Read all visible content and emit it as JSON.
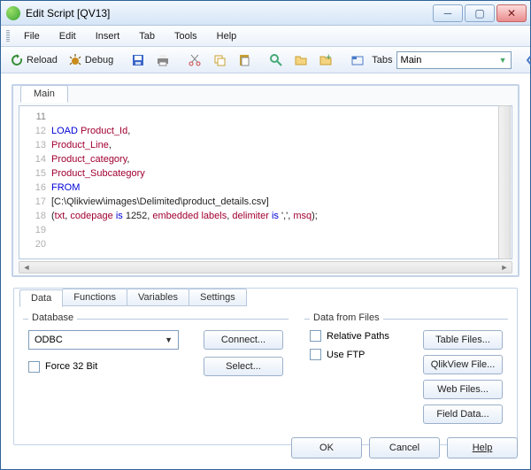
{
  "window": {
    "title": "Edit Script [QV13]"
  },
  "menu": {
    "file": "File",
    "edit": "Edit",
    "insert": "Insert",
    "tab": "Tab",
    "tools": "Tools",
    "help": "Help"
  },
  "toolbar": {
    "reload": "Reload",
    "debug": "Debug",
    "tabs_label": "Tabs",
    "tabs_value": "Main"
  },
  "editor": {
    "tab": "Main",
    "lines": [
      {
        "n": 11,
        "frag": []
      },
      {
        "n": 12,
        "frag": [
          [
            "kw",
            "LOAD"
          ],
          [
            "plain",
            " "
          ],
          [
            "id",
            "Product_Id"
          ],
          [
            "plain",
            ","
          ]
        ]
      },
      {
        "n": 13,
        "frag": [
          [
            "plain",
            "     "
          ],
          [
            "id",
            "Product_Line"
          ],
          [
            "plain",
            ","
          ]
        ]
      },
      {
        "n": 14,
        "frag": [
          [
            "plain",
            "     "
          ],
          [
            "id",
            "Product_category"
          ],
          [
            "plain",
            ","
          ]
        ]
      },
      {
        "n": 15,
        "frag": [
          [
            "plain",
            "     "
          ],
          [
            "id",
            "Product_Subcategory"
          ]
        ]
      },
      {
        "n": 16,
        "frag": [
          [
            "kw",
            "FROM"
          ]
        ]
      },
      {
        "n": 17,
        "frag": [
          [
            "plain",
            "[C:\\Qlikview\\images\\Delimited\\product_details.csv]"
          ]
        ]
      },
      {
        "n": 18,
        "frag": [
          [
            "plain",
            "("
          ],
          [
            "id",
            "txt"
          ],
          [
            "plain",
            ", "
          ],
          [
            "id",
            "codepage"
          ],
          [
            "plain",
            " "
          ],
          [
            "kw",
            "is"
          ],
          [
            "plain",
            " 1252, "
          ],
          [
            "id",
            "embedded labels"
          ],
          [
            "plain",
            ", "
          ],
          [
            "id",
            "delimiter"
          ],
          [
            "plain",
            " "
          ],
          [
            "kw",
            "is"
          ],
          [
            "plain",
            " ',', "
          ],
          [
            "id",
            "msq"
          ],
          [
            "plain",
            ");"
          ]
        ]
      },
      {
        "n": 19,
        "frag": []
      },
      {
        "n": 20,
        "frag": []
      }
    ]
  },
  "lower": {
    "tabs": {
      "data": "Data",
      "functions": "Functions",
      "variables": "Variables",
      "settings": "Settings"
    },
    "database": {
      "legend": "Database",
      "type": "ODBC",
      "connect": "Connect...",
      "select": "Select...",
      "force32": "Force 32 Bit"
    },
    "files": {
      "legend": "Data from Files",
      "relative": "Relative Paths",
      "ftp": "Use FTP",
      "table": "Table Files...",
      "qlik": "QlikView File...",
      "web": "Web Files...",
      "field": "Field Data..."
    }
  },
  "buttons": {
    "ok": "OK",
    "cancel": "Cancel",
    "help": "Help"
  }
}
